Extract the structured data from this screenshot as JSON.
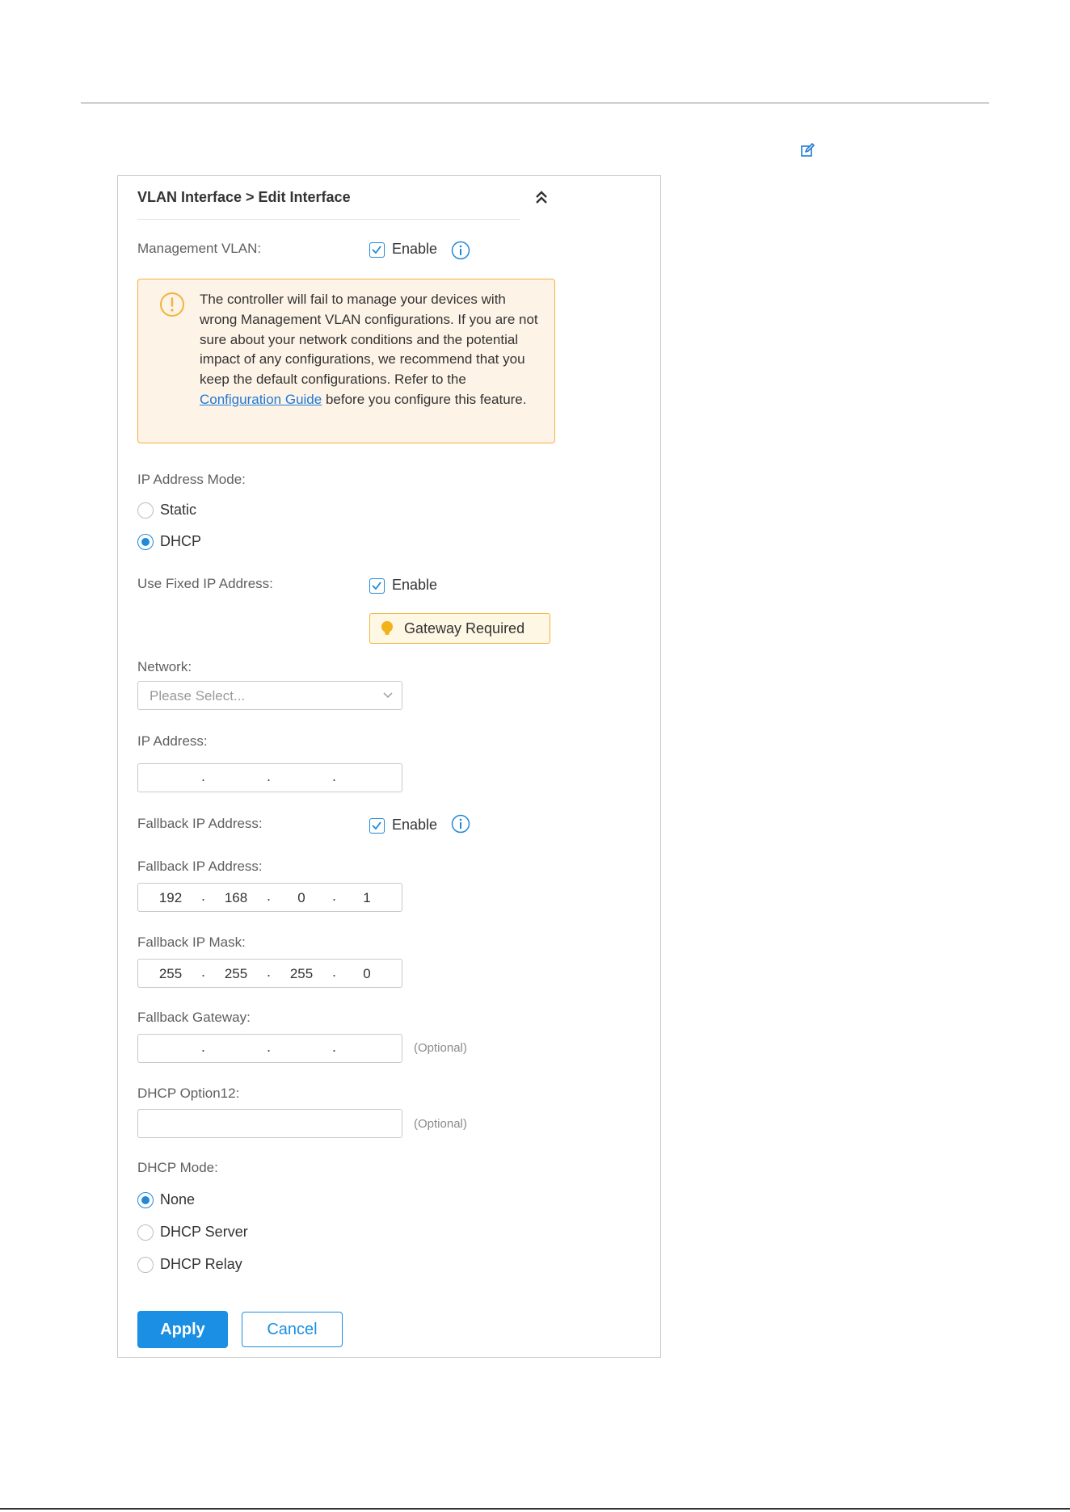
{
  "panel": {
    "title": "VLAN Interface > Edit Interface"
  },
  "management_vlan": {
    "label": "Management VLAN:",
    "enable_label": "Enable",
    "checked": true
  },
  "warning": {
    "text_before_link": "The controller will fail to manage your devices with wrong Management VLAN configurations. If you are not sure about your network conditions and the potential impact of any configurations, we recommend that you keep the default configurations. Refer to the ",
    "link_text": "Configuration Guide",
    "text_after_link": " before you configure this feature."
  },
  "ip_address_mode": {
    "label": "IP Address Mode:",
    "options": [
      "Static",
      "DHCP"
    ],
    "selected": "DHCP"
  },
  "fixed_ip": {
    "label": "Use Fixed IP Address:",
    "enable_label": "Enable",
    "checked": true,
    "badge": "Gateway Required"
  },
  "network": {
    "label": "Network:",
    "placeholder": "Please Select..."
  },
  "ip_address": {
    "label": "IP Address:",
    "octets": [
      "",
      "",
      "",
      ""
    ]
  },
  "fallback_ip_toggle": {
    "label": "Fallback IP Address:",
    "enable_label": "Enable",
    "checked": true
  },
  "fallback_ip": {
    "label": "Fallback IP Address:",
    "octets": [
      "192",
      "168",
      "0",
      "1"
    ]
  },
  "fallback_mask": {
    "label": "Fallback IP Mask:",
    "octets": [
      "255",
      "255",
      "255",
      "0"
    ]
  },
  "fallback_gateway": {
    "label": "Fallback Gateway:",
    "octets": [
      "",
      "",
      "",
      ""
    ],
    "hint": "(Optional)"
  },
  "dhcp_option12": {
    "label": "DHCP Option12:",
    "hint": "(Optional)",
    "value": ""
  },
  "dhcp_mode": {
    "label": "DHCP Mode:",
    "options": [
      "None",
      "DHCP Server",
      "DHCP Relay"
    ],
    "selected": "None"
  },
  "actions": {
    "apply": "Apply",
    "cancel": "Cancel"
  },
  "colors": {
    "accent": "#1a8fe3",
    "warning_border": "#f1b33d",
    "warning_bg": "#fdf3e7"
  }
}
